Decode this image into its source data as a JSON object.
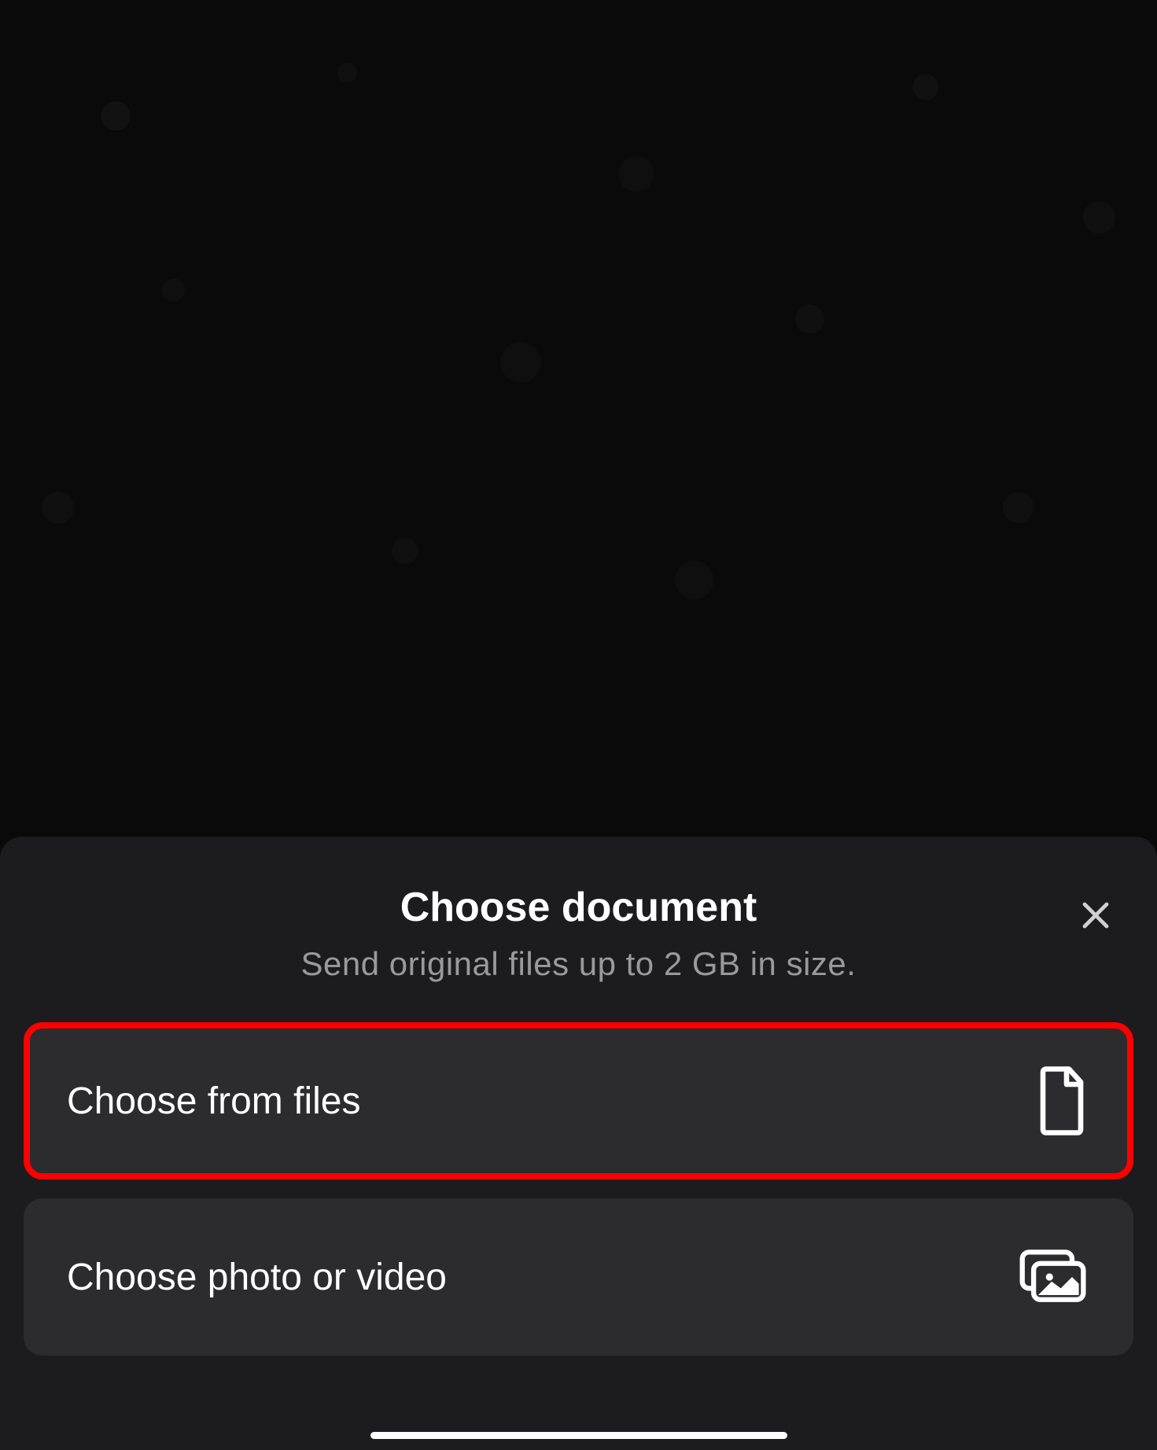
{
  "sheet": {
    "title": "Choose document",
    "subtitle": "Send original files up to 2 GB in size.",
    "options": [
      {
        "label": "Choose from files",
        "icon": "document-icon",
        "highlighted": true
      },
      {
        "label": "Choose photo or video",
        "icon": "gallery-icon",
        "highlighted": false
      }
    ]
  }
}
